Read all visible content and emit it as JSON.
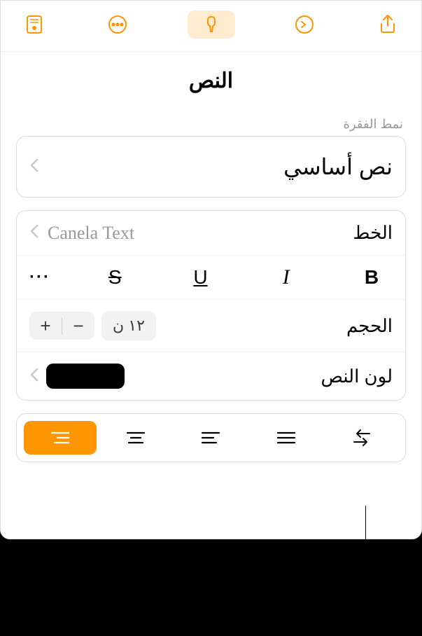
{
  "toolbar": {
    "icons": [
      "document-view-icon",
      "more-icon",
      "format-brush-icon",
      "redo-icon",
      "share-icon"
    ]
  },
  "title": "النص",
  "paragraph": {
    "section_label": "نمط الفقرة",
    "style_name": "نص أساسي"
  },
  "font": {
    "label": "الخط",
    "value": "Canela Text"
  },
  "text_styles": {
    "bold": "B",
    "italic": "I",
    "underline": "U",
    "strike": "S"
  },
  "size": {
    "label": "الحجم",
    "value": "١٢ ن",
    "minus": "−",
    "plus": "+"
  },
  "color": {
    "label": "لون النص",
    "swatch": "#000000"
  },
  "alignment": {
    "options": [
      "align-right",
      "align-center",
      "align-left",
      "justify",
      "direction-swap"
    ],
    "active": "align-right"
  }
}
